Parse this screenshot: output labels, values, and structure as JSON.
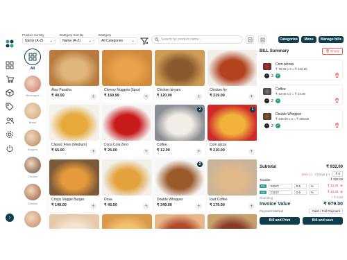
{
  "filters": [
    {
      "label": "Product Sort By",
      "value": "Name (A-Z)"
    },
    {
      "label": "Category Sort By",
      "value": "Name (A-Z)"
    },
    {
      "label": "Category",
      "value": "All Categories"
    }
  ],
  "search": {
    "placeholder": "Search by product name..."
  },
  "top_buttons": {
    "categories": "Categories",
    "menu": "Menu",
    "manage": "Manage bills"
  },
  "categories": [
    {
      "label": "All",
      "color": "#fff"
    },
    {
      "label": "Beverages",
      "color": "#c9766a"
    },
    {
      "label": "Bread",
      "color": "#d4a574"
    },
    {
      "label": "Burgers",
      "color": "#b8845a"
    },
    {
      "label": "Chicken",
      "color": "#6b4a3a"
    },
    {
      "label": "Chinese",
      "color": "#a0553a"
    },
    {
      "label": "",
      "color": "#c58a66"
    }
  ],
  "products": [
    {
      "name": "Aloo Paratha",
      "price": "₹ 40.00",
      "bg": "#b87a3e",
      "fg": "#e0b57a",
      "badge": ""
    },
    {
      "name": "Cheesy Nuggets (6pcs)",
      "price": "₹ 169.99",
      "bg": "#d08a3a",
      "fg": "#e9a24b",
      "badge": ""
    },
    {
      "name": "Chicken biryani",
      "price": "₹ 120.00",
      "bg": "#cf9c55",
      "fg": "#8a5a2e",
      "badge": ""
    },
    {
      "name": "Chicken fry",
      "price": "₹ 219.00",
      "bg": "#f0eee8",
      "fg": "#b3421f",
      "badge": ""
    },
    {
      "name": "Classic Fries (Medium)",
      "price": "₹ 65.00",
      "bg": "#f3f1ea",
      "fg": "#e6a93a",
      "badge": ""
    },
    {
      "name": "Coca Cola Zero",
      "price": "₹ 25.00",
      "bg": "#f4f4f4",
      "fg": "#c81c1c",
      "badge": ""
    },
    {
      "name": "Coffee",
      "price": "₹ 12.00",
      "bg": "#8a8d93",
      "fg": "#f2ede6",
      "badge": "2"
    },
    {
      "name": "Corn pizza",
      "price": "₹ 210.00",
      "bg": "#cf2a2a",
      "fg": "#f1b23b",
      "badge": "1"
    },
    {
      "name": "Crispy Veggie Burger",
      "price": "₹ 149.00",
      "bg": "#7d5a3a",
      "fg": "#e49a3a",
      "badge": ""
    },
    {
      "name": "Dosa",
      "price": "₹ 45.00",
      "bg": "#f1f0ea",
      "fg": "#e4a23e",
      "badge": ""
    },
    {
      "name": "Double Whopper",
      "price": "₹ 349.00",
      "bg": "#f5f5f5",
      "fg": "#9b5a2a",
      "badge": "2"
    },
    {
      "name": "Iced Coffee",
      "price": "₹ 179.00",
      "bg": "#c9b49a",
      "fg": "#e0b88a",
      "badge": ""
    },
    {
      "name": "",
      "price": "",
      "bg": "#e6c9a8",
      "fg": "#f3e3cf",
      "badge": ""
    },
    {
      "name": "",
      "price": "",
      "bg": "#d99b4a",
      "fg": "#f4c06a",
      "badge": ""
    },
    {
      "name": "",
      "price": "",
      "bg": "#e8b88a",
      "fg": "#b04a2a",
      "badge": ""
    },
    {
      "name": "",
      "price": "",
      "bg": "#c7a06a",
      "fg": "#8a3a2a",
      "badge": ""
    }
  ],
  "bill": {
    "title": "BILL Summary",
    "empty": "Empty",
    "items": [
      {
        "name": "Corn pizzas",
        "price": "₹ 70.00 x 3 = ₹ 210.00",
        "qty": "3",
        "color": "#cf2a2a"
      },
      {
        "name": "Coffee",
        "price": "₹ 12.00 x 2 = ₹ 24.00",
        "qty": "2",
        "color": "#7b7b7b"
      },
      {
        "name": "Double Whopper",
        "price": "₹ 349.00 x 2 = ₹ 698.00",
        "qty": "2",
        "color": "#9b5a2a"
      }
    ],
    "subtotal_label": "Subtotal",
    "subtotal": "₹ 932.00",
    "disc_label": "Disc (-)",
    "charge_label": "Charge (+)",
    "disc_value": "₹ 0",
    "taxable_label": "Taxable",
    "taxable": "₹ 932.00",
    "gst": [
      {
        "tag": "CS",
        "name": "SGST",
        "rate": "2.5",
        "unit": "%",
        "amount": "₹ 23.30"
      },
      {
        "tag": "CS",
        "name": "CGST",
        "rate": "2.5",
        "unit": "%",
        "amount": "₹ 23.30"
      }
    ],
    "rounding_label": "Rounding",
    "rounding": "+ ₹ 0.40",
    "invoice_label": "Invoice Value",
    "invoice": "₹ 979.00",
    "payment_label": "Payment Method",
    "payment": "Cash / Full Payment",
    "btn_print": "Bill and Print",
    "btn_save": "Bill and save"
  }
}
